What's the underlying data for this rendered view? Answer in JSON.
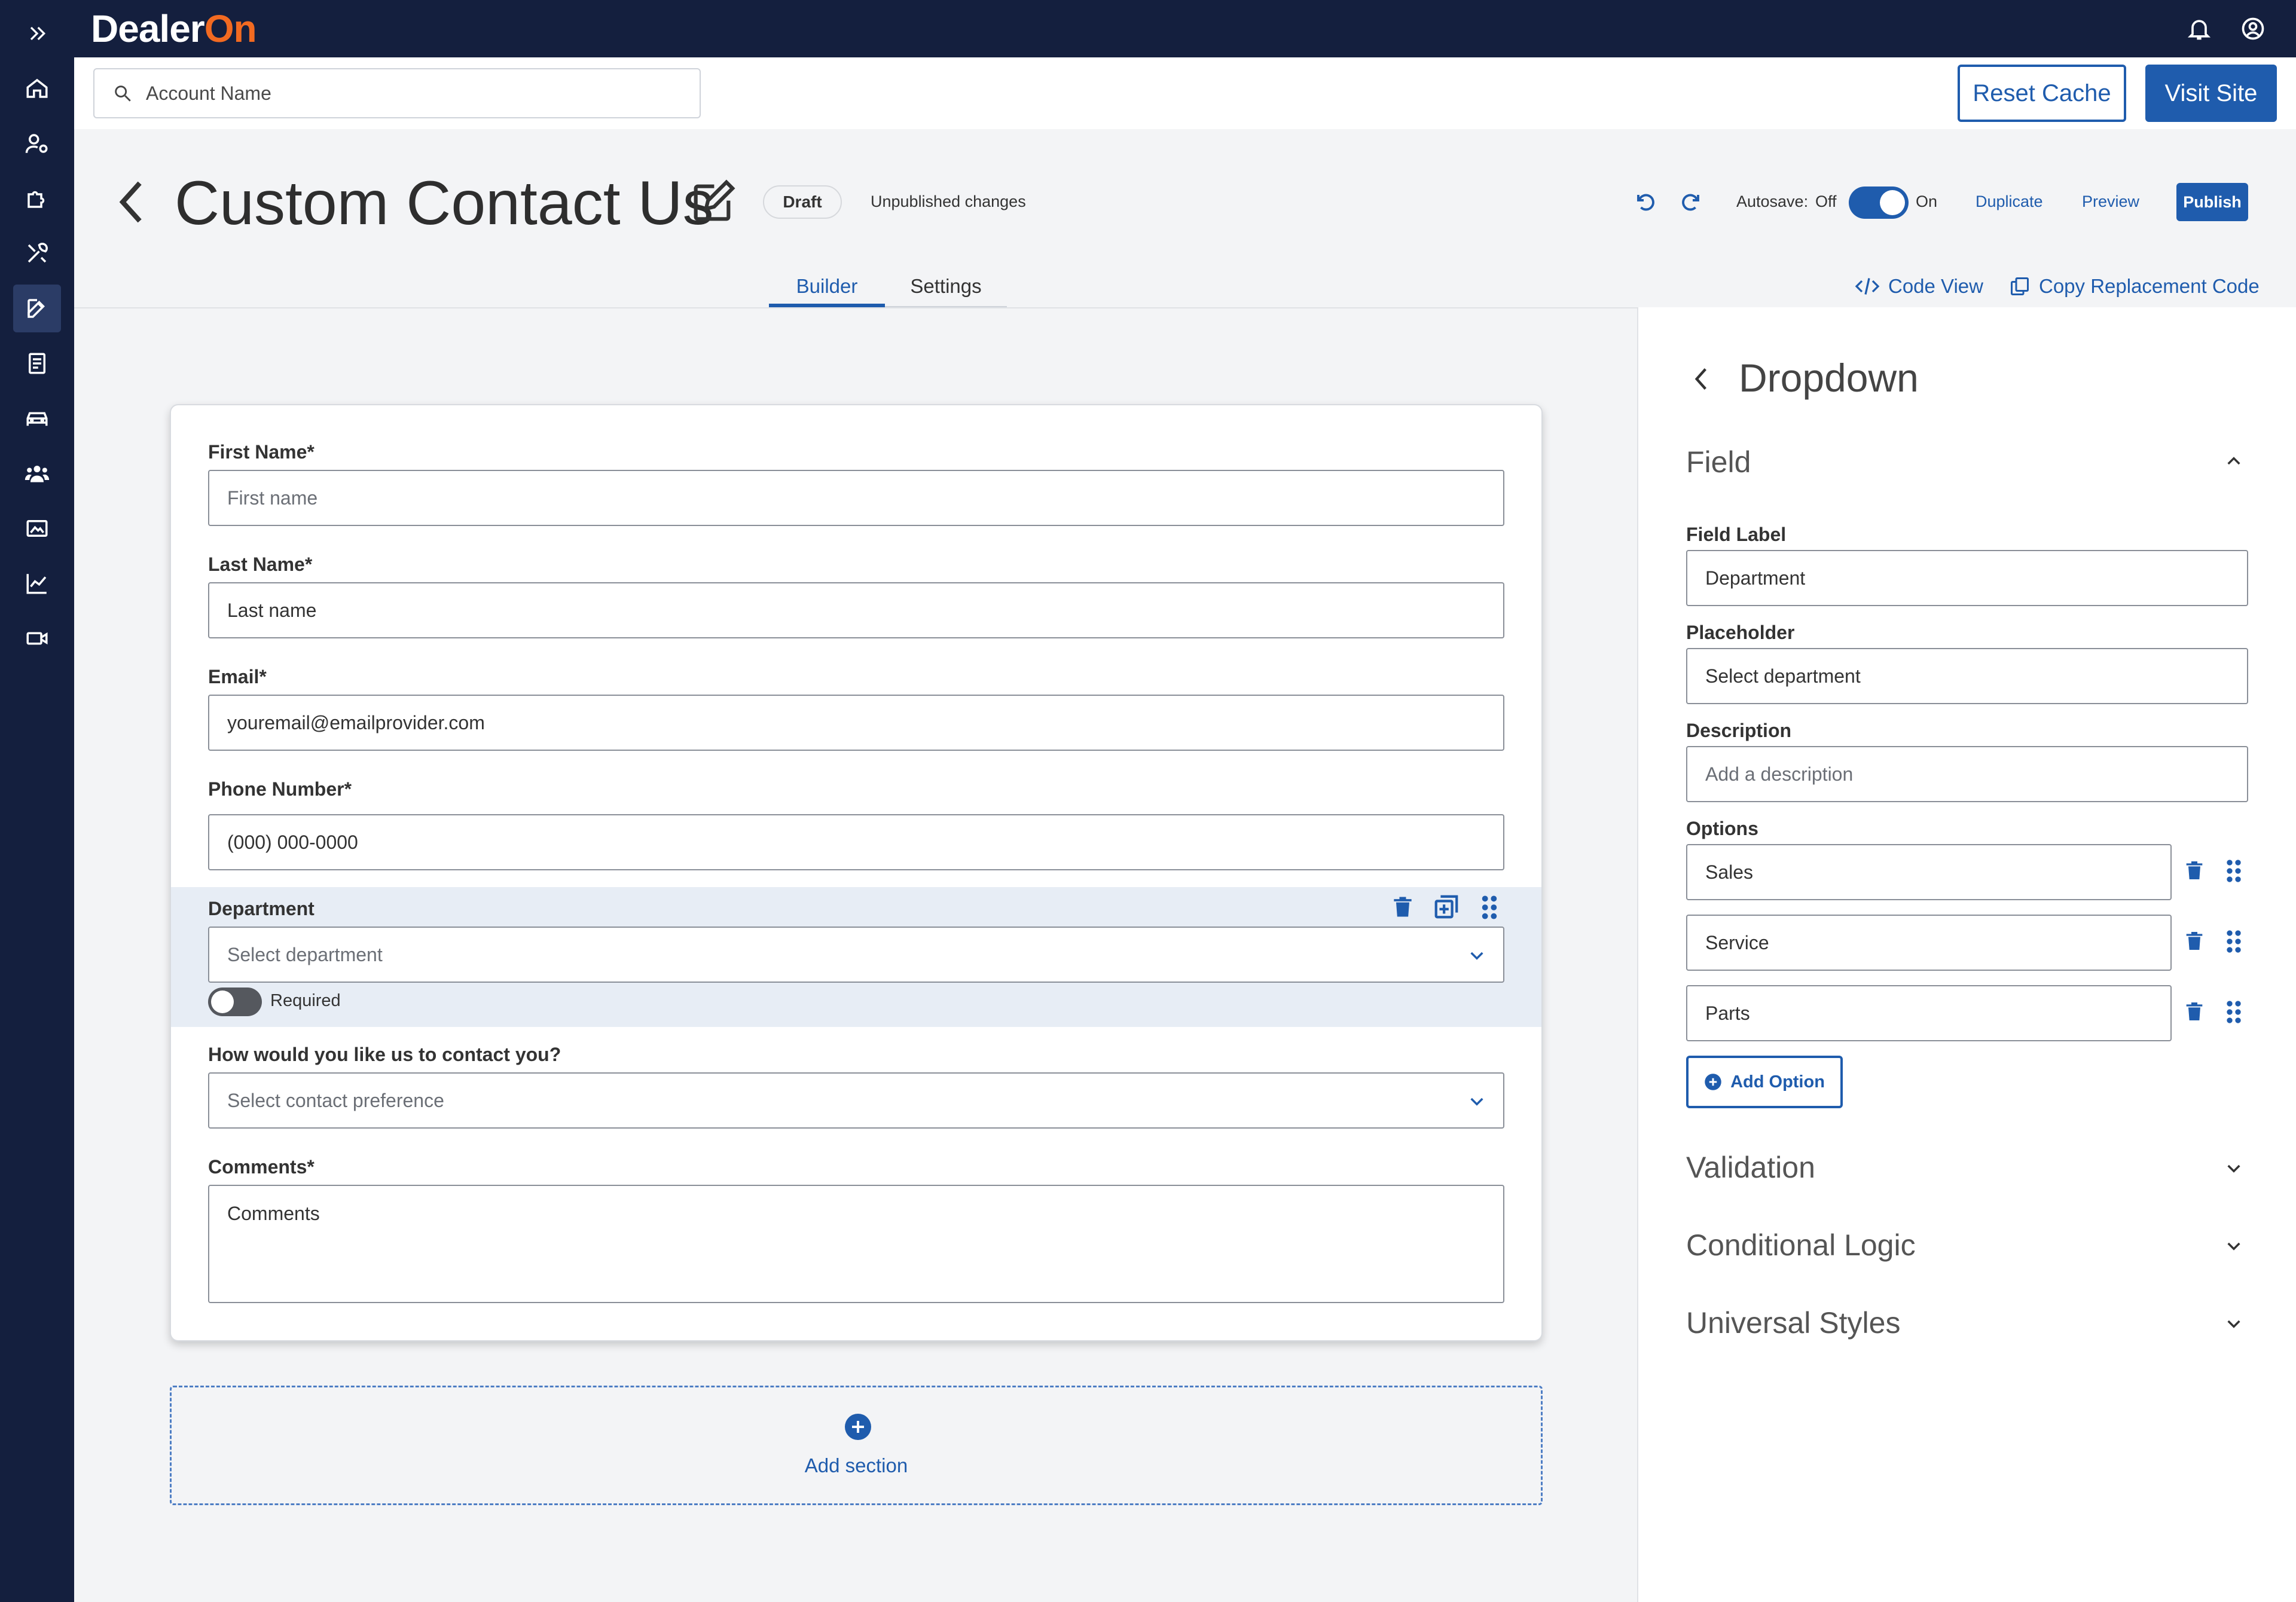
{
  "app": {
    "logo_text": "Dealer",
    "logo_accent": "On",
    "brand_color": "#141f3e",
    "accent_color": "#1f5cad"
  },
  "search": {
    "placeholder": "Account Name"
  },
  "header_buttons": {
    "reset_cache": "Reset Cache",
    "visit_site": "Visit Site"
  },
  "page": {
    "title": "Custom Contact Us",
    "status_badge": "Draft",
    "status_text": "Unpublished changes",
    "autosave_label": "Autosave:",
    "autosave_off": "Off",
    "autosave_on": "On",
    "autosave_state": "on",
    "duplicate": "Duplicate",
    "preview": "Preview",
    "publish": "Publish"
  },
  "tabs": [
    {
      "label": "Builder",
      "active": true
    },
    {
      "label": "Settings",
      "active": false
    }
  ],
  "tools": {
    "code_view": "Code View",
    "copy_code": "Copy Replacement Code"
  },
  "form": {
    "fields": [
      {
        "label": "First Name*",
        "placeholder": "First name"
      },
      {
        "label": "Last Name*",
        "value": "Last name"
      },
      {
        "label": "Email*",
        "value": "youremail@emailprovider.com"
      },
      {
        "label": "Phone Number*",
        "value": "(000) 000-0000"
      },
      {
        "label": "Department",
        "placeholder": "Select department",
        "required_label": "Required",
        "required": false
      },
      {
        "label": "How would you like us to contact you?",
        "placeholder": "Select contact preference"
      },
      {
        "label": "Comments*",
        "value": "Comments"
      }
    ],
    "add_section": "Add section"
  },
  "panel": {
    "title": "Dropdown",
    "field_section": "Field",
    "field_label_label": "Field Label",
    "field_label_value": "Department",
    "placeholder_label": "Placeholder",
    "placeholder_value": "Select department",
    "description_label": "Description",
    "description_placeholder": "Add a description",
    "options_label": "Options",
    "options": [
      "Sales",
      "Service",
      "Parts"
    ],
    "add_option": "Add Option",
    "sections": [
      "Validation",
      "Conditional Logic",
      "Universal Styles"
    ]
  }
}
